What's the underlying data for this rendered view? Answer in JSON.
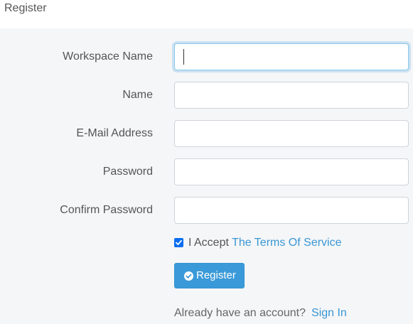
{
  "header": {
    "title": "Register"
  },
  "form": {
    "fields": [
      {
        "label": "Workspace Name",
        "value": ""
      },
      {
        "label": "Name",
        "value": ""
      },
      {
        "label": "E-Mail Address",
        "value": ""
      },
      {
        "label": "Password",
        "value": ""
      },
      {
        "label": "Confirm Password",
        "value": ""
      }
    ],
    "terms": {
      "checked": true,
      "prefix": "I Accept",
      "link": "The Terms Of Service"
    },
    "submit_label": "Register",
    "signin_prompt": "Already have an account?",
    "signin_link": "Sign In"
  },
  "colors": {
    "accent": "#3a9ad9",
    "link": "#3a97d4",
    "background": "#f5f6f8"
  },
  "icons": {
    "submit": "check-circle-icon",
    "terms": "checkbox-checked-icon"
  }
}
